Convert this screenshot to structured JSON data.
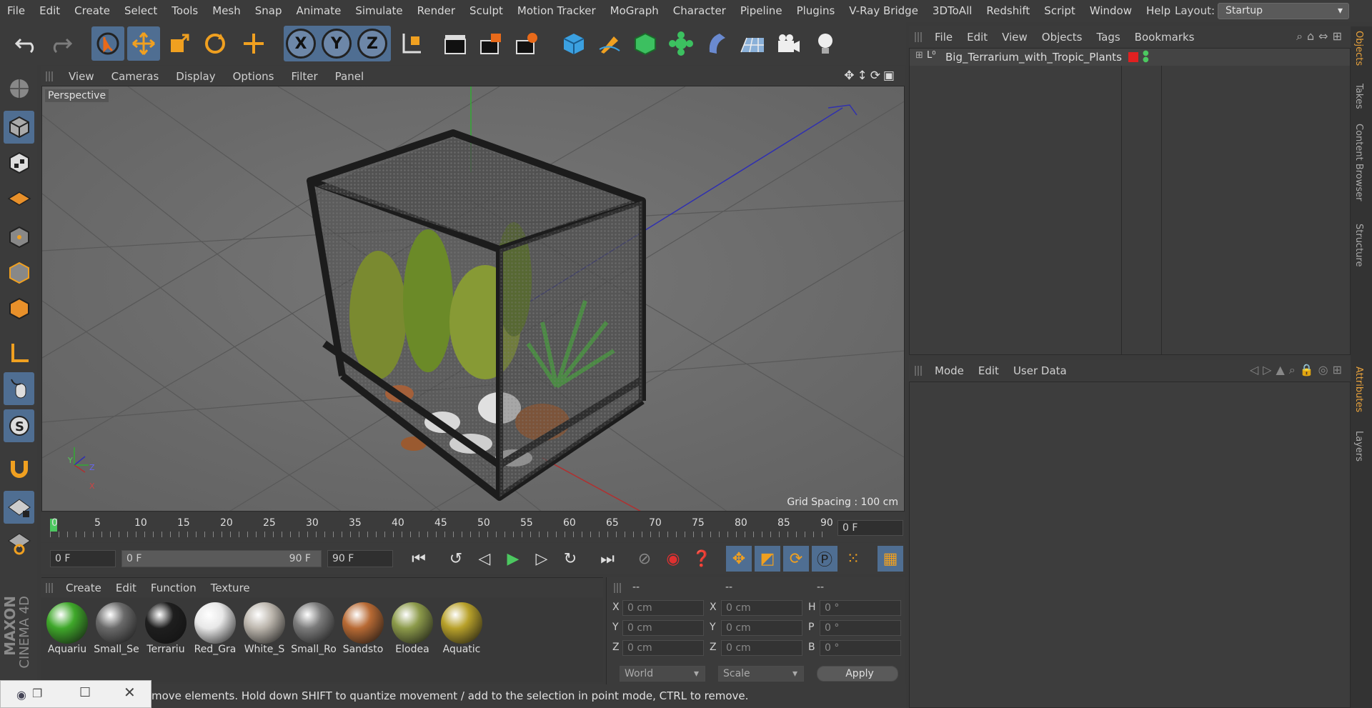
{
  "menubar": {
    "items": [
      "File",
      "Edit",
      "Create",
      "Select",
      "Tools",
      "Mesh",
      "Snap",
      "Animate",
      "Simulate",
      "Render",
      "Sculpt",
      "Motion Tracker",
      "MoGraph",
      "Character",
      "Pipeline",
      "Plugins",
      "V-Ray Bridge",
      "3DToAll",
      "Redshift",
      "Script",
      "Window",
      "Help"
    ],
    "layout_label": "Layout:",
    "layout_value": "Startup"
  },
  "viewport": {
    "menu": [
      "View",
      "Cameras",
      "Display",
      "Options",
      "Filter",
      "Panel"
    ],
    "label": "Perspective",
    "grid_spacing": "Grid Spacing : 100 cm",
    "axis_labels": {
      "y": "Y",
      "z": "Z",
      "x": "X"
    }
  },
  "timeline": {
    "ticks": [
      "0",
      "5",
      "10",
      "15",
      "20",
      "25",
      "30",
      "35",
      "40",
      "45",
      "50",
      "55",
      "60",
      "65",
      "70",
      "75",
      "80",
      "85",
      "90"
    ],
    "current_frame": "0 F",
    "start_field": "0 F",
    "range_start": "0 F",
    "range_end": "90 F",
    "end_field": "90 F"
  },
  "materials": {
    "menu": [
      "Create",
      "Edit",
      "Function",
      "Texture"
    ],
    "items": [
      {
        "name": "Aquariu",
        "color": "#3fa82a"
      },
      {
        "name": "Small_Se",
        "color": "#6a6a6a"
      },
      {
        "name": "Terrariu",
        "color": "#1e1e1e"
      },
      {
        "name": "Red_Gra",
        "color": "#e8e8e8"
      },
      {
        "name": "White_S",
        "color": "#bdb7ae"
      },
      {
        "name": "Small_Ro",
        "color": "#7b7b7b"
      },
      {
        "name": "Sandsto",
        "color": "#b86a34"
      },
      {
        "name": "Elodea",
        "color": "#8c9a4a"
      },
      {
        "name": "Aquatic",
        "color": "#b8a12a"
      }
    ]
  },
  "coords": {
    "headers": [
      "--",
      "--",
      "--"
    ],
    "rows": [
      {
        "a": "X",
        "av": "0 cm",
        "b": "X",
        "bv": "0 cm",
        "c": "H",
        "cv": "0 °"
      },
      {
        "a": "Y",
        "av": "0 cm",
        "b": "Y",
        "bv": "0 cm",
        "c": "P",
        "cv": "0 °"
      },
      {
        "a": "Z",
        "av": "0 cm",
        "b": "Z",
        "bv": "0 cm",
        "c": "B",
        "cv": "0 °"
      }
    ],
    "mode_select": "World",
    "scale_select": "Scale",
    "apply_label": "Apply"
  },
  "objects": {
    "menu": [
      "File",
      "Edit",
      "View",
      "Objects",
      "Tags",
      "Bookmarks"
    ],
    "items": [
      {
        "name": "Big_Terrarium_with_Tropic_Plants"
      }
    ]
  },
  "attributes": {
    "menu": [
      "Mode",
      "Edit",
      "User Data"
    ]
  },
  "side_tabs": [
    "Objects",
    "Takes",
    "Content Browser",
    "Structure",
    "Attributes",
    "Layers"
  ],
  "status_text": "move elements. Hold down SHIFT to quantize movement / add to the selection in point mode, CTRL to remove.",
  "brand": {
    "line1": "MAXON",
    "line2": "CINEMA 4D"
  }
}
